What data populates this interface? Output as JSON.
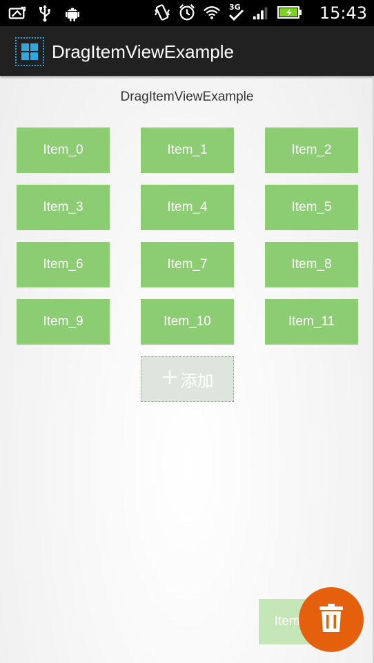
{
  "status_bar": {
    "time": "15:43",
    "left_icons": [
      "screenshot-icon",
      "usb-icon",
      "android-debug-icon"
    ],
    "right_icons": [
      "vibrate-icon",
      "alarm-icon",
      "wifi-icon",
      "3g-icon",
      "signal-icon",
      "battery-icon"
    ]
  },
  "app_bar": {
    "title": "DragItemViewExample",
    "icon": "grid-app-icon"
  },
  "main": {
    "heading": "DragItemViewExample",
    "items": [
      "Item_0",
      "Item_1",
      "Item_2",
      "Item_3",
      "Item_4",
      "Item_5",
      "Item_6",
      "Item_7",
      "Item_8",
      "Item_9",
      "Item_10",
      "Item_11"
    ],
    "add_button": {
      "icon": "plus-icon",
      "label": "添加"
    },
    "dragging_item_label": "Item_",
    "trash_icon": "trash-icon"
  },
  "colors": {
    "tile": "#8ccd73",
    "tile_ghost": "#c5e6b8",
    "add_tile_bg": "#dee5dc",
    "fab": "#e5600d",
    "app_bar": "#212121",
    "status_bar": "#000000"
  }
}
